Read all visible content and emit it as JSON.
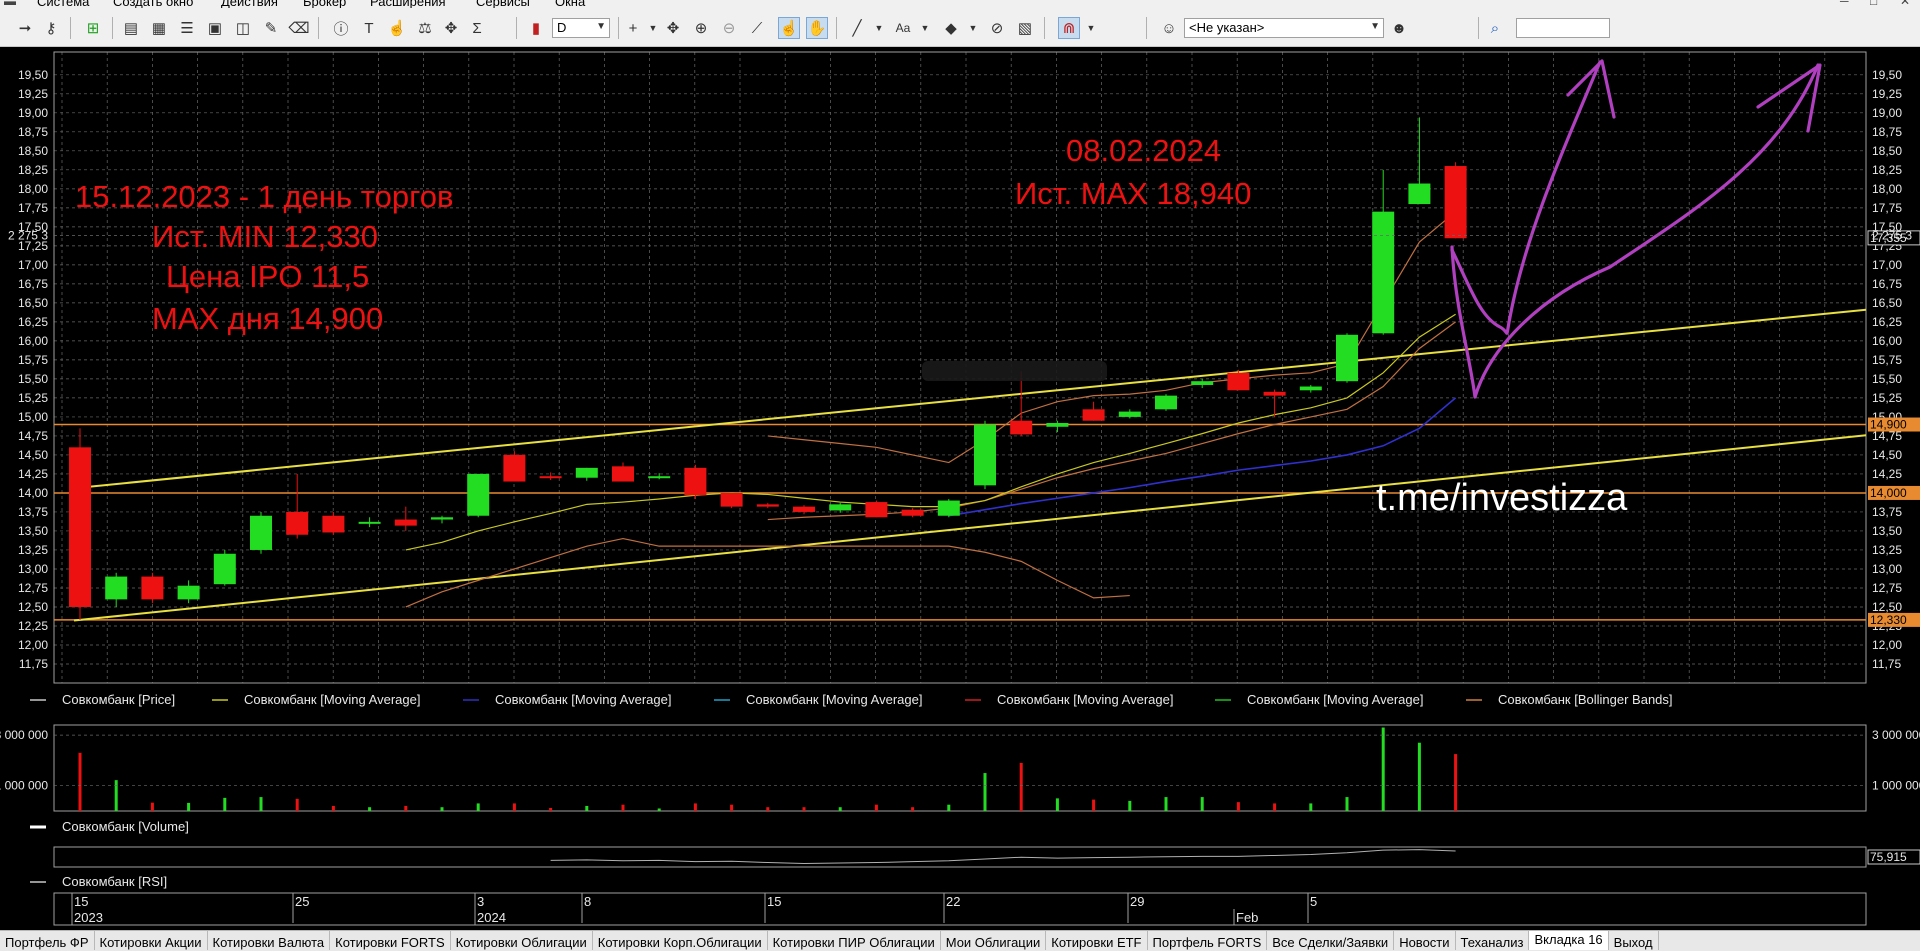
{
  "menu": [
    "Система",
    "Создать окно",
    "Действия",
    "Брокер",
    "Расширения",
    "Сервисы",
    "Окна"
  ],
  "toolbar": {
    "interval": "D",
    "client": "<Не указан>",
    "search_value": ""
  },
  "chart_data": {
    "type": "candlestick",
    "price_ticks": [
      "19,50",
      "19,25",
      "19,00",
      "18,75",
      "18,50",
      "18,25",
      "18,00",
      "17,75",
      "17,50",
      "17,25",
      "17,00",
      "16,75",
      "16,50",
      "16,25",
      "16,00",
      "15,75",
      "15,50",
      "15,25",
      "15,00",
      "14,75",
      "14,50",
      "14,25",
      "14,00",
      "13,75",
      "13,50",
      "13,25",
      "13,00",
      "12,75",
      "12,50",
      "12,25",
      "12,00",
      "11,75"
    ],
    "ylim": [
      11.5,
      19.8
    ],
    "candles": [
      {
        "o": 14.6,
        "h": 14.85,
        "l": 12.33,
        "c": 12.5,
        "v": 2300000
      },
      {
        "o": 12.6,
        "h": 12.95,
        "l": 12.5,
        "c": 12.9,
        "v": 1220000
      },
      {
        "o": 12.9,
        "h": 12.95,
        "l": 12.55,
        "c": 12.6,
        "v": 330000
      },
      {
        "o": 12.6,
        "h": 12.85,
        "l": 12.55,
        "c": 12.78,
        "v": 320000
      },
      {
        "o": 12.8,
        "h": 13.25,
        "l": 12.78,
        "c": 13.2,
        "v": 520000
      },
      {
        "o": 13.25,
        "h": 13.75,
        "l": 13.2,
        "c": 13.7,
        "v": 550000
      },
      {
        "o": 13.75,
        "h": 14.25,
        "l": 13.4,
        "c": 13.45,
        "v": 480000
      },
      {
        "o": 13.7,
        "h": 13.75,
        "l": 13.45,
        "c": 13.48,
        "v": 200000
      },
      {
        "o": 13.6,
        "h": 13.68,
        "l": 13.55,
        "c": 13.62,
        "v": 150000
      },
      {
        "o": 13.65,
        "h": 13.82,
        "l": 13.5,
        "c": 13.57,
        "v": 200000
      },
      {
        "o": 13.65,
        "h": 13.7,
        "l": 13.6,
        "c": 13.68,
        "v": 150000
      },
      {
        "o": 13.7,
        "h": 14.25,
        "l": 13.68,
        "c": 14.25,
        "v": 300000
      },
      {
        "o": 14.5,
        "h": 14.55,
        "l": 14.15,
        "c": 14.15,
        "v": 300000
      },
      {
        "o": 14.22,
        "h": 14.27,
        "l": 14.17,
        "c": 14.2,
        "v": 120000
      },
      {
        "o": 14.2,
        "h": 14.33,
        "l": 14.16,
        "c": 14.33,
        "v": 200000
      },
      {
        "o": 14.35,
        "h": 14.4,
        "l": 14.15,
        "c": 14.15,
        "v": 250000
      },
      {
        "o": 14.22,
        "h": 14.26,
        "l": 14.18,
        "c": 14.22,
        "v": 100000
      },
      {
        "o": 14.33,
        "h": 14.37,
        "l": 13.92,
        "c": 13.97,
        "v": 300000
      },
      {
        "o": 14.0,
        "h": 14.0,
        "l": 13.8,
        "c": 13.82,
        "v": 250000
      },
      {
        "o": 13.85,
        "h": 13.87,
        "l": 13.8,
        "c": 13.82,
        "v": 150000
      },
      {
        "o": 13.82,
        "h": 13.84,
        "l": 13.72,
        "c": 13.75,
        "v": 150000
      },
      {
        "o": 13.77,
        "h": 13.87,
        "l": 13.74,
        "c": 13.85,
        "v": 150000
      },
      {
        "o": 13.88,
        "h": 13.9,
        "l": 13.68,
        "c": 13.68,
        "v": 250000
      },
      {
        "o": 13.78,
        "h": 13.8,
        "l": 13.68,
        "c": 13.7,
        "v": 150000
      },
      {
        "o": 13.7,
        "h": 13.92,
        "l": 13.68,
        "c": 13.9,
        "v": 250000
      },
      {
        "o": 14.1,
        "h": 14.95,
        "l": 14.05,
        "c": 14.9,
        "v": 1500000
      },
      {
        "o": 14.95,
        "h": 15.6,
        "l": 14.75,
        "c": 14.77,
        "v": 1900000
      },
      {
        "o": 14.87,
        "h": 14.95,
        "l": 14.8,
        "c": 14.92,
        "v": 500000
      },
      {
        "o": 15.1,
        "h": 15.2,
        "l": 14.95,
        "c": 14.95,
        "v": 450000
      },
      {
        "o": 15.0,
        "h": 15.1,
        "l": 14.98,
        "c": 15.07,
        "v": 400000
      },
      {
        "o": 15.1,
        "h": 15.3,
        "l": 15.08,
        "c": 15.28,
        "v": 550000
      },
      {
        "o": 15.42,
        "h": 15.5,
        "l": 15.38,
        "c": 15.47,
        "v": 550000
      },
      {
        "o": 15.58,
        "h": 15.62,
        "l": 15.35,
        "c": 15.35,
        "v": 350000
      },
      {
        "o": 15.33,
        "h": 15.36,
        "l": 15.0,
        "c": 15.28,
        "v": 300000
      },
      {
        "o": 15.35,
        "h": 15.42,
        "l": 15.32,
        "c": 15.4,
        "v": 300000
      },
      {
        "o": 15.47,
        "h": 16.1,
        "l": 15.45,
        "c": 16.08,
        "v": 550000
      },
      {
        "o": 16.1,
        "h": 18.25,
        "l": 16.08,
        "c": 17.7,
        "v": 3300000
      },
      {
        "o": 17.8,
        "h": 18.94,
        "l": 17.8,
        "c": 18.07,
        "v": 2700000
      },
      {
        "o": 18.3,
        "h": 18.35,
        "l": 17.35,
        "c": 17.35,
        "v": 2250000
      }
    ],
    "volume_ticks": [
      "3 000 000",
      "2 275 3",
      "1 000 000"
    ],
    "volume_ylim": [
      0,
      3400000
    ],
    "ma_fast": [
      null,
      null,
      null,
      null,
      null,
      null,
      null,
      null,
      null,
      13.25,
      13.35,
      13.5,
      13.62,
      13.73,
      13.85,
      13.88,
      13.92,
      13.97,
      14.0,
      13.98,
      13.93,
      13.88,
      13.85,
      13.82,
      13.82,
      13.9,
      14.08,
      14.25,
      14.4,
      14.52,
      14.65,
      14.78,
      14.92,
      15.03,
      15.12,
      15.25,
      15.58,
      16.05,
      16.35
    ],
    "ma_slow": [
      null,
      null,
      null,
      null,
      null,
      null,
      null,
      null,
      null,
      null,
      null,
      null,
      null,
      null,
      null,
      null,
      null,
      null,
      null,
      null,
      null,
      null,
      null,
      null,
      13.7,
      13.78,
      13.86,
      13.93,
      14.0,
      14.07,
      14.15,
      14.22,
      14.3,
      14.36,
      14.42,
      14.5,
      14.62,
      14.85,
      15.25
    ],
    "bb_upper": [
      null,
      null,
      null,
      null,
      null,
      null,
      null,
      null,
      null,
      null,
      null,
      null,
      null,
      null,
      null,
      null,
      null,
      null,
      null,
      14.75,
      14.7,
      14.65,
      14.6,
      14.5,
      14.4,
      14.7,
      15.05,
      15.2,
      15.28,
      15.3,
      15.35,
      15.45,
      15.5,
      15.55,
      15.58,
      15.7,
      16.5,
      17.3,
      17.7
    ],
    "bb_middle": [
      null,
      null,
      null,
      null,
      null,
      null,
      null,
      null,
      null,
      null,
      null,
      null,
      null,
      null,
      null,
      null,
      null,
      null,
      null,
      13.65,
      13.68,
      13.7,
      13.72,
      13.75,
      13.8,
      13.9,
      14.05,
      14.2,
      14.32,
      14.42,
      14.52,
      14.65,
      14.78,
      14.9,
      15.0,
      15.1,
      15.4,
      15.9,
      16.25
    ],
    "bb_lower": [
      null,
      null,
      null,
      null,
      null,
      null,
      null,
      null,
      null,
      12.5,
      12.7,
      12.85,
      13.0,
      13.15,
      13.3,
      13.4,
      13.3,
      13.3,
      13.3,
      13.3,
      13.3,
      13.3,
      13.3,
      13.3,
      13.3,
      13.22,
      13.1,
      12.85,
      12.62,
      12.65
    ],
    "h_levels": [
      {
        "label": "14,900"
      },
      {
        "label": "14,000"
      },
      {
        "label": "12,330"
      }
    ],
    "price_label": "17,355",
    "rsi_label": "75,915",
    "rsi": [
      null,
      null,
      null,
      null,
      null,
      null,
      null,
      null,
      null,
      null,
      null,
      null,
      null,
      55,
      56,
      54,
      55,
      52,
      53,
      50,
      48,
      49,
      50,
      52,
      54,
      58,
      62,
      60,
      61,
      62,
      63,
      64,
      64,
      66,
      68,
      72,
      78,
      79,
      76
    ],
    "legend": [
      "Совкомбанк [Price]",
      "Совкомбанк [Moving Average]",
      "Совкомбанк [Moving Average]",
      "Совкомбанк [Moving Average]",
      "Совкомбанк [Moving Average]",
      "Совкомбанк [Moving Average]",
      "Совкомбанк [Bollinger Bands]"
    ],
    "legend_colors": [
      "#c8c8c8",
      "#c8c820",
      "#3030c0",
      "#20a0c8",
      "#d02020",
      "#20c020",
      "#d08040"
    ],
    "volume_label": "Совкомбанк [Volume]",
    "rsi_panel_label": "Совкомбанк [RSI]",
    "date_labels": [
      "15",
      "25",
      "3",
      "8",
      "15",
      "22",
      "29",
      "5"
    ],
    "date_labels_lower": [
      "2023",
      "2024",
      "Feb"
    ],
    "annotations": {
      "left": [
        "15.12.2023 - 1 день торгов",
        "Ист. MIN  12,330",
        "Цена IPO  11,5",
        "MAX дня  14,900"
      ],
      "top_date": "08.02.2024",
      "top_max": "Ист. MAX    18,940",
      "link": "t.me/investizza"
    },
    "colors": {
      "up": "#22dd22",
      "down": "#ee1111",
      "level": "#e88a30",
      "channel": "#e8e040",
      "annotation": "#ee1111",
      "drawing": "#b040c0"
    }
  },
  "tabs": [
    "Портфель ФР",
    "Котировки Акции",
    "Котировки Валюта",
    "Котировки FORTS",
    "Котировки Облигации",
    "Котировки Корп.Облигации",
    "Котировки ПИР Облигации",
    "Мои Облигации",
    "Котировки ETF",
    "Портфель FORTS",
    "Все Сделки/Заявки",
    "Новости",
    "Теханализ",
    "Вкладка 16",
    "Выход"
  ]
}
